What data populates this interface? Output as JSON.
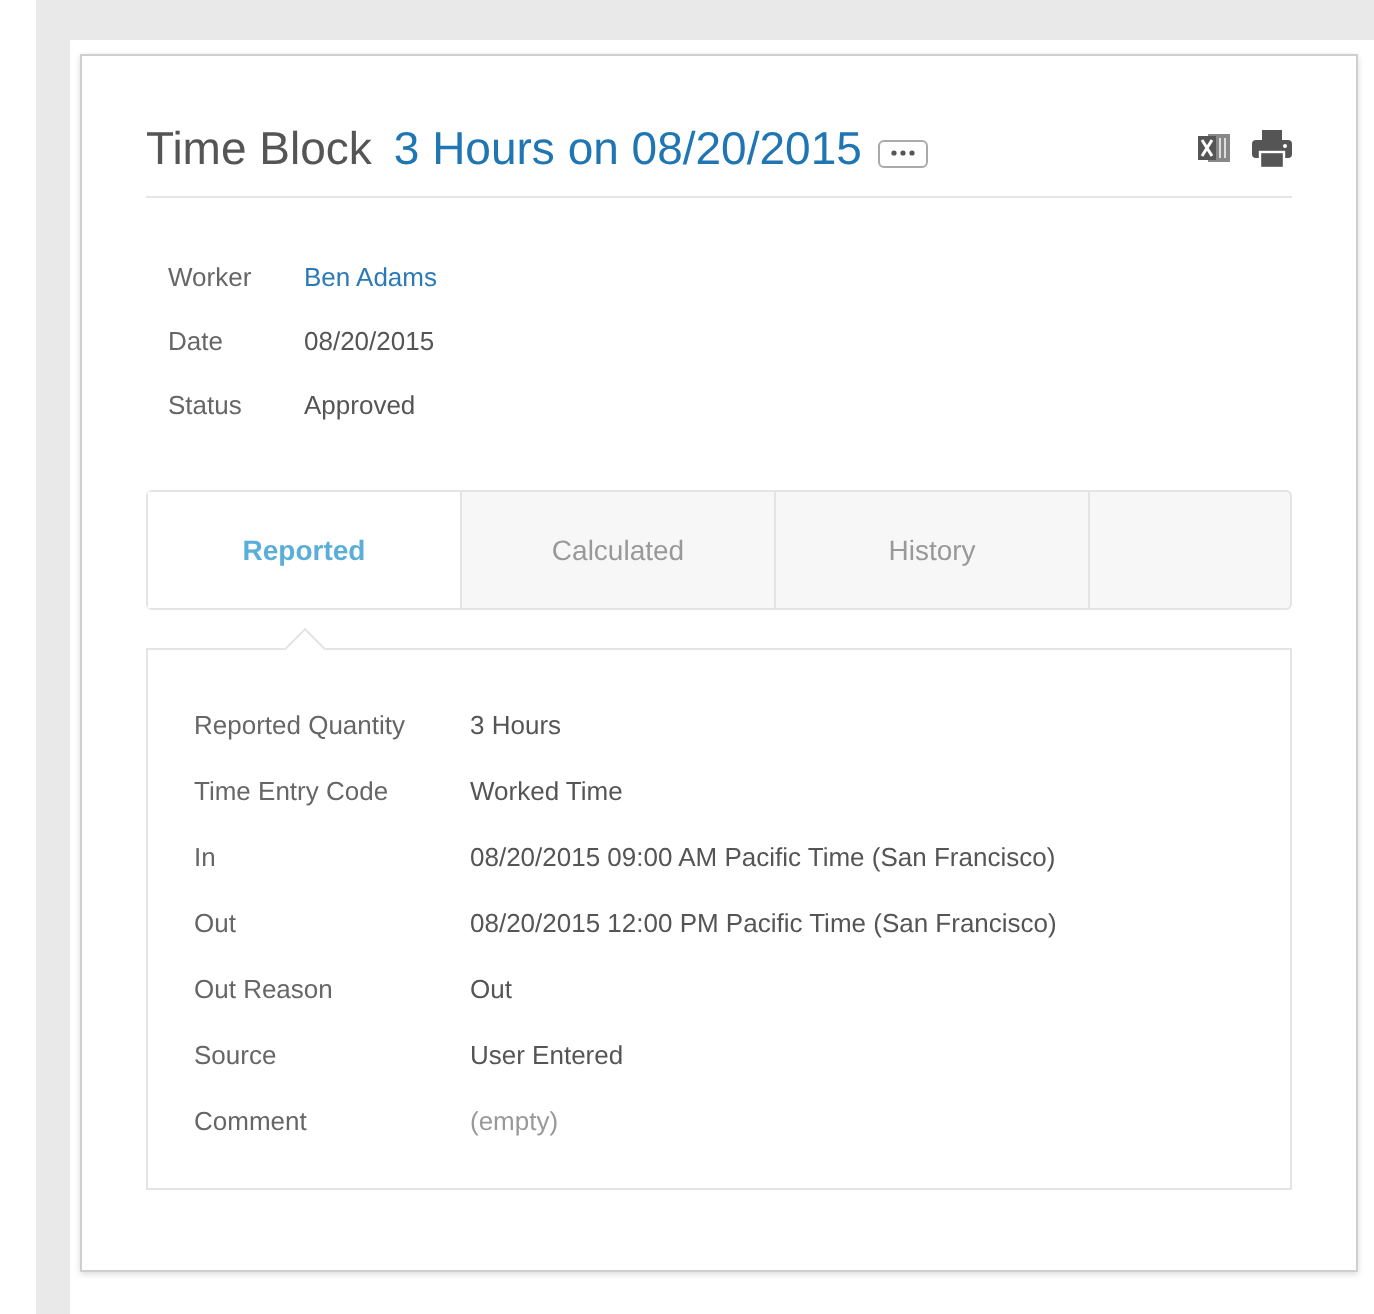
{
  "header": {
    "title": "Time Block",
    "subtitle": "3 Hours on 08/20/2015"
  },
  "summary": [
    {
      "label": "Worker",
      "value": "Ben Adams",
      "kind": "link"
    },
    {
      "label": "Date",
      "value": "08/20/2015",
      "kind": "text"
    },
    {
      "label": "Status",
      "value": "Approved",
      "kind": "text"
    }
  ],
  "tabs": [
    {
      "label": "Reported",
      "selected": true
    },
    {
      "label": "Calculated",
      "selected": false
    },
    {
      "label": "History",
      "selected": false
    }
  ],
  "details": [
    {
      "label": "Reported Quantity",
      "value": "3 Hours",
      "kind": "text"
    },
    {
      "label": "Time Entry Code",
      "value": "Worked Time",
      "kind": "text"
    },
    {
      "label": "In",
      "value": "08/20/2015 09:00 AM Pacific Time (San Francisco)",
      "kind": "text"
    },
    {
      "label": "Out",
      "value": "08/20/2015 12:00 PM Pacific Time (San Francisco)",
      "kind": "text"
    },
    {
      "label": "Out Reason",
      "value": "Out",
      "kind": "text"
    },
    {
      "label": "Source",
      "value": "User Entered",
      "kind": "text"
    },
    {
      "label": "Comment",
      "value": "(empty)",
      "kind": "empty"
    }
  ]
}
